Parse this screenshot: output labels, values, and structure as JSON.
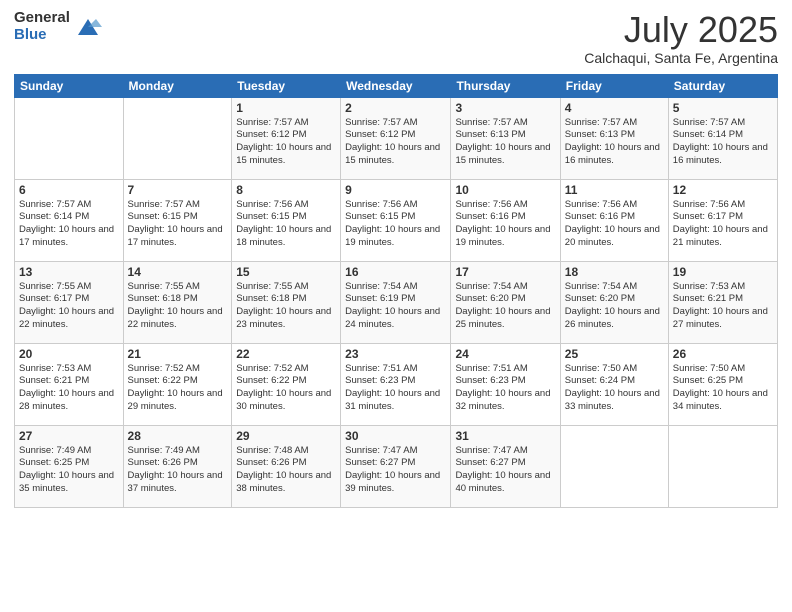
{
  "header": {
    "logo_general": "General",
    "logo_blue": "Blue",
    "month": "July 2025",
    "location": "Calchaqui, Santa Fe, Argentina"
  },
  "weekdays": [
    "Sunday",
    "Monday",
    "Tuesday",
    "Wednesday",
    "Thursday",
    "Friday",
    "Saturday"
  ],
  "weeks": [
    [
      {
        "day": "",
        "info": ""
      },
      {
        "day": "",
        "info": ""
      },
      {
        "day": "1",
        "info": "Sunrise: 7:57 AM\nSunset: 6:12 PM\nDaylight: 10 hours and 15 minutes."
      },
      {
        "day": "2",
        "info": "Sunrise: 7:57 AM\nSunset: 6:12 PM\nDaylight: 10 hours and 15 minutes."
      },
      {
        "day": "3",
        "info": "Sunrise: 7:57 AM\nSunset: 6:13 PM\nDaylight: 10 hours and 15 minutes."
      },
      {
        "day": "4",
        "info": "Sunrise: 7:57 AM\nSunset: 6:13 PM\nDaylight: 10 hours and 16 minutes."
      },
      {
        "day": "5",
        "info": "Sunrise: 7:57 AM\nSunset: 6:14 PM\nDaylight: 10 hours and 16 minutes."
      }
    ],
    [
      {
        "day": "6",
        "info": "Sunrise: 7:57 AM\nSunset: 6:14 PM\nDaylight: 10 hours and 17 minutes."
      },
      {
        "day": "7",
        "info": "Sunrise: 7:57 AM\nSunset: 6:15 PM\nDaylight: 10 hours and 17 minutes."
      },
      {
        "day": "8",
        "info": "Sunrise: 7:56 AM\nSunset: 6:15 PM\nDaylight: 10 hours and 18 minutes."
      },
      {
        "day": "9",
        "info": "Sunrise: 7:56 AM\nSunset: 6:15 PM\nDaylight: 10 hours and 19 minutes."
      },
      {
        "day": "10",
        "info": "Sunrise: 7:56 AM\nSunset: 6:16 PM\nDaylight: 10 hours and 19 minutes."
      },
      {
        "day": "11",
        "info": "Sunrise: 7:56 AM\nSunset: 6:16 PM\nDaylight: 10 hours and 20 minutes."
      },
      {
        "day": "12",
        "info": "Sunrise: 7:56 AM\nSunset: 6:17 PM\nDaylight: 10 hours and 21 minutes."
      }
    ],
    [
      {
        "day": "13",
        "info": "Sunrise: 7:55 AM\nSunset: 6:17 PM\nDaylight: 10 hours and 22 minutes."
      },
      {
        "day": "14",
        "info": "Sunrise: 7:55 AM\nSunset: 6:18 PM\nDaylight: 10 hours and 22 minutes."
      },
      {
        "day": "15",
        "info": "Sunrise: 7:55 AM\nSunset: 6:18 PM\nDaylight: 10 hours and 23 minutes."
      },
      {
        "day": "16",
        "info": "Sunrise: 7:54 AM\nSunset: 6:19 PM\nDaylight: 10 hours and 24 minutes."
      },
      {
        "day": "17",
        "info": "Sunrise: 7:54 AM\nSunset: 6:20 PM\nDaylight: 10 hours and 25 minutes."
      },
      {
        "day": "18",
        "info": "Sunrise: 7:54 AM\nSunset: 6:20 PM\nDaylight: 10 hours and 26 minutes."
      },
      {
        "day": "19",
        "info": "Sunrise: 7:53 AM\nSunset: 6:21 PM\nDaylight: 10 hours and 27 minutes."
      }
    ],
    [
      {
        "day": "20",
        "info": "Sunrise: 7:53 AM\nSunset: 6:21 PM\nDaylight: 10 hours and 28 minutes."
      },
      {
        "day": "21",
        "info": "Sunrise: 7:52 AM\nSunset: 6:22 PM\nDaylight: 10 hours and 29 minutes."
      },
      {
        "day": "22",
        "info": "Sunrise: 7:52 AM\nSunset: 6:22 PM\nDaylight: 10 hours and 30 minutes."
      },
      {
        "day": "23",
        "info": "Sunrise: 7:51 AM\nSunset: 6:23 PM\nDaylight: 10 hours and 31 minutes."
      },
      {
        "day": "24",
        "info": "Sunrise: 7:51 AM\nSunset: 6:23 PM\nDaylight: 10 hours and 32 minutes."
      },
      {
        "day": "25",
        "info": "Sunrise: 7:50 AM\nSunset: 6:24 PM\nDaylight: 10 hours and 33 minutes."
      },
      {
        "day": "26",
        "info": "Sunrise: 7:50 AM\nSunset: 6:25 PM\nDaylight: 10 hours and 34 minutes."
      }
    ],
    [
      {
        "day": "27",
        "info": "Sunrise: 7:49 AM\nSunset: 6:25 PM\nDaylight: 10 hours and 35 minutes."
      },
      {
        "day": "28",
        "info": "Sunrise: 7:49 AM\nSunset: 6:26 PM\nDaylight: 10 hours and 37 minutes."
      },
      {
        "day": "29",
        "info": "Sunrise: 7:48 AM\nSunset: 6:26 PM\nDaylight: 10 hours and 38 minutes."
      },
      {
        "day": "30",
        "info": "Sunrise: 7:47 AM\nSunset: 6:27 PM\nDaylight: 10 hours and 39 minutes."
      },
      {
        "day": "31",
        "info": "Sunrise: 7:47 AM\nSunset: 6:27 PM\nDaylight: 10 hours and 40 minutes."
      },
      {
        "day": "",
        "info": ""
      },
      {
        "day": "",
        "info": ""
      }
    ]
  ]
}
